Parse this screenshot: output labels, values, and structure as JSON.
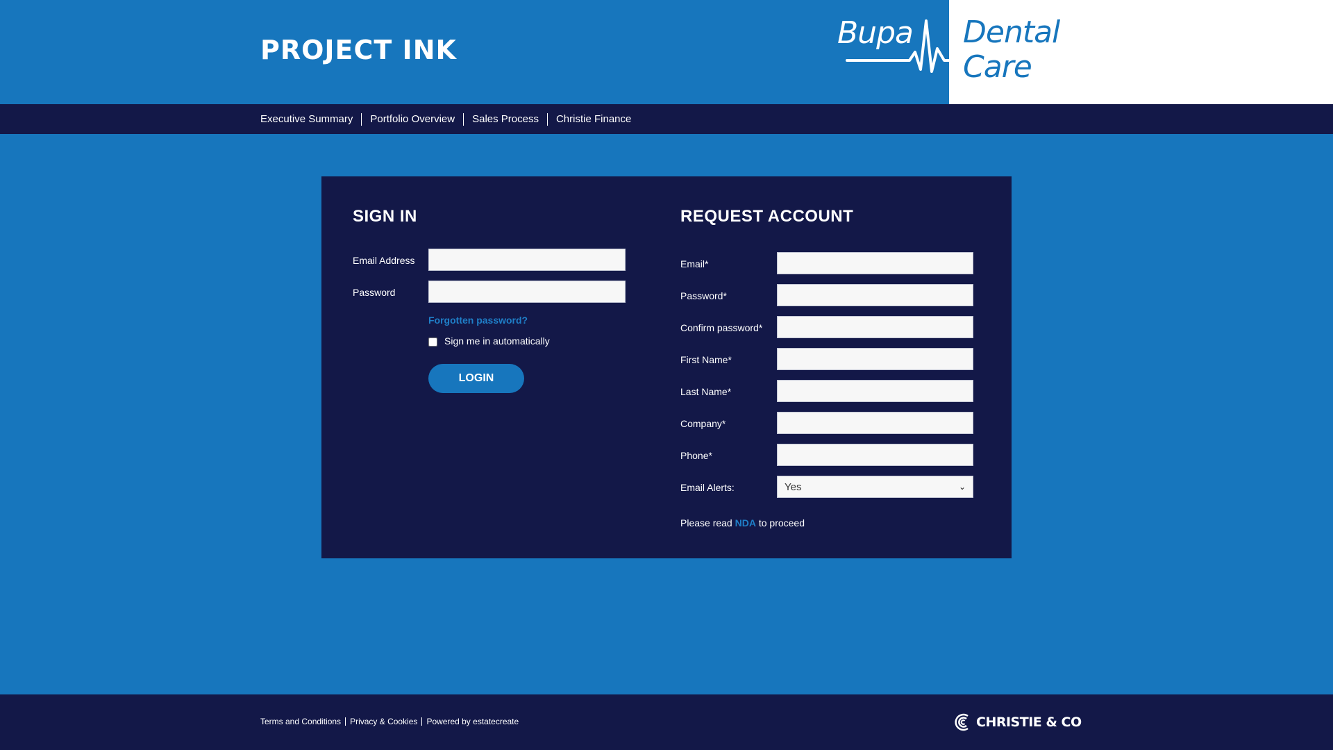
{
  "header": {
    "title": "PROJECT INK",
    "brand_word1": "Bupa",
    "brand_word2_line1": "Dental",
    "brand_word2_line2": "Care"
  },
  "nav": {
    "items": [
      "Executive Summary",
      "Portfolio Overview",
      "Sales Process",
      "Christie Finance"
    ]
  },
  "sign_in": {
    "title": "SIGN IN",
    "email_label": "Email Address",
    "password_label": "Password",
    "forgot_link": "Forgotten password?",
    "remember_label": "Sign me in automatically",
    "remember_checked": false,
    "login_button": "LOGIN"
  },
  "request_account": {
    "title": "REQUEST ACCOUNT",
    "fields": {
      "email": "Email*",
      "password": "Password*",
      "confirm_password": "Confirm password*",
      "first_name": "First Name*",
      "last_name": "Last Name*",
      "company": "Company*",
      "phone": "Phone*",
      "email_alerts": "Email Alerts:"
    },
    "email_alerts_value": "Yes",
    "nda_prefix": "Please read",
    "nda_link": "NDA",
    "nda_suffix": "to proceed"
  },
  "footer": {
    "links": [
      "Terms and Conditions",
      "Privacy & Cookies",
      "Powered by estatecreate"
    ],
    "logo_text": "CHRISTIE & CO"
  },
  "colors": {
    "brand_blue": "#1776bd",
    "navy": "#131848",
    "link_blue": "#1f7fc8"
  }
}
